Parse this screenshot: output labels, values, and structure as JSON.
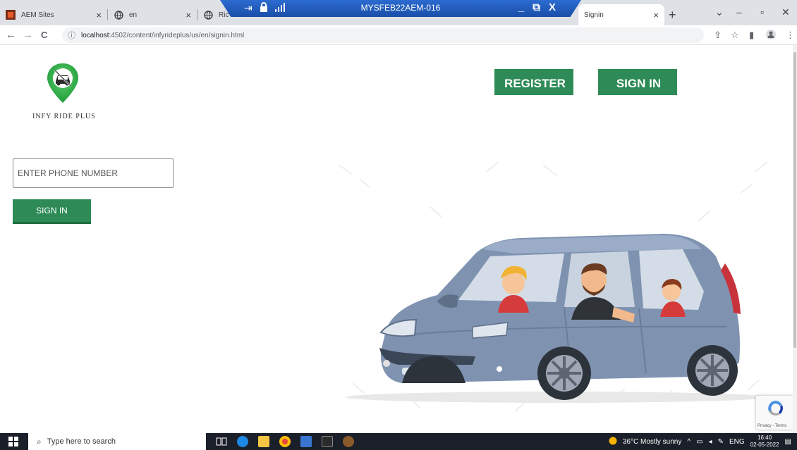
{
  "browser": {
    "tabs": [
      {
        "label": "AEM Sites"
      },
      {
        "label": "en"
      },
      {
        "label": "Ric"
      },
      {
        "label": "Signin"
      }
    ],
    "close_glyph": "×",
    "new_tab_glyph": "+",
    "url_host": "localhost",
    "url_rest": ":4502/content/infyrideplus/us/en/signin.html",
    "nav": {
      "back": "←",
      "forward": "→",
      "reload": "C",
      "info": "ⓘ"
    }
  },
  "remote_session": {
    "title": "MYSFEB22AEM-016",
    "controls": {
      "minimize": "_",
      "restore": "⧉",
      "close": "X"
    }
  },
  "header": {
    "brand": "INFY RIDE PLUS",
    "register_label": "REGISTER",
    "signin_label": "SIGN IN"
  },
  "form": {
    "phone_placeholder": "ENTER PHONE NUMBER",
    "phone_value": "",
    "submit_label": "SIGN IN"
  },
  "recaptcha": {
    "terms": "Privacy - Terms"
  },
  "taskbar": {
    "search_placeholder": "Type here to search",
    "weather": "36°C  Mostly sunny",
    "language": "ENG",
    "time": "16:40",
    "date": "02-05-2022"
  },
  "colors": {
    "accent": "#2e8b57",
    "tabstrip": "#dee1e6",
    "remote_bar": "#1f5cc1",
    "taskbar": "#1b1f2a"
  },
  "icons": [
    "aem-icon",
    "globe-icon",
    "pin-icon",
    "lock-icon",
    "signal-icon",
    "car-pin-logo-icon",
    "recaptcha-icon",
    "windows-start-icon",
    "search-icon",
    "weather-sun-icon"
  ]
}
